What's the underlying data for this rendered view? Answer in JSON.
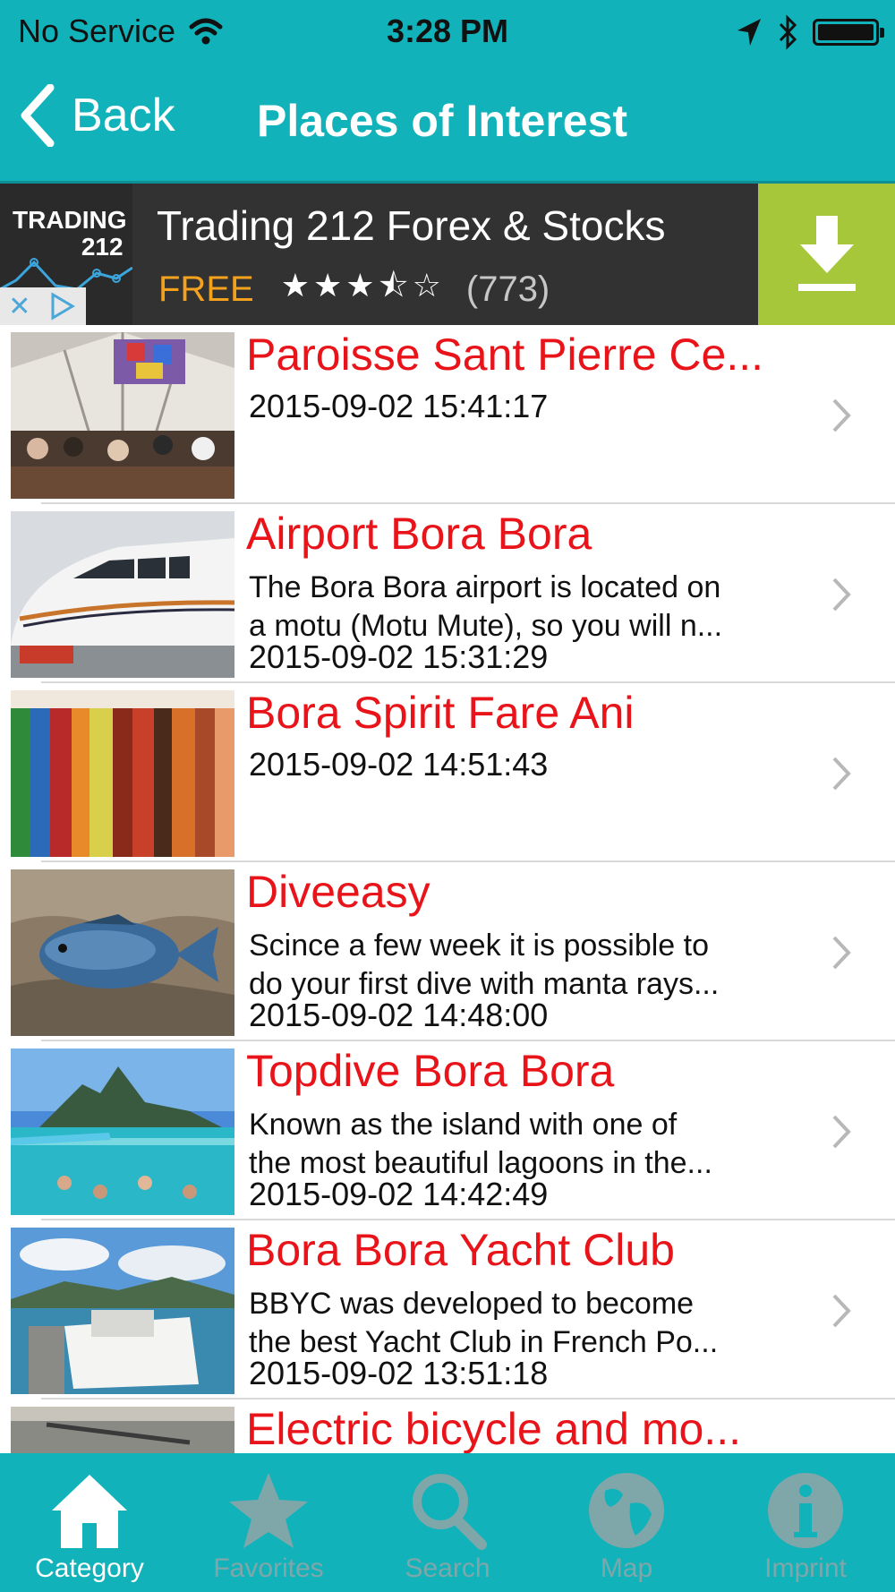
{
  "status_bar": {
    "carrier": "No Service",
    "time": "3:28 PM"
  },
  "nav": {
    "back_label": "Back",
    "title": "Places of Interest"
  },
  "ad": {
    "logo_line1": "TRADING",
    "logo_line2": "212",
    "title": "Trading 212 Forex & Stocks",
    "price": "FREE",
    "stars": "★★★⯪☆",
    "rating_count": "(773)"
  },
  "items": [
    {
      "title": "Paroisse Sant Pierre Ce...",
      "desc1": "",
      "desc2": "",
      "date": "2015-09-02 15:41:17",
      "thumb": "church-interior"
    },
    {
      "title": "Airport Bora Bora",
      "desc1": "The Bora Bora airport is located on",
      "desc2": "a motu (Motu Mute), so you will n...",
      "date": "2015-09-02 15:31:29",
      "thumb": "airplane"
    },
    {
      "title": "Bora Spirit Fare Ani",
      "desc1": "",
      "desc2": "",
      "date": "2015-09-02 14:51:43",
      "thumb": "colorful-strings"
    },
    {
      "title": "Diveeasy",
      "desc1": "Scince a few week it is possible to",
      "desc2": "do your first dive with manta rays...",
      "date": "2015-09-02 14:48:00",
      "thumb": "fish-reef"
    },
    {
      "title": "Topdive Bora Bora",
      "desc1": "Known as the island with one of",
      "desc2": "the most beautiful lagoons in the...",
      "date": "2015-09-02 14:42:49",
      "thumb": "island-lagoon"
    },
    {
      "title": "Bora Bora Yacht Club",
      "desc1": "BBYC was developed to become",
      "desc2": "the best Yacht Club in French Po...",
      "date": "2015-09-02 13:51:18",
      "thumb": "yacht"
    },
    {
      "title": "Electric bicycle and mo...",
      "desc1": "",
      "desc2": "",
      "date": "",
      "thumb": "bicycle"
    }
  ],
  "tabs": [
    {
      "label": "Category",
      "icon": "home-icon"
    },
    {
      "label": "Favorites",
      "icon": "star-icon"
    },
    {
      "label": "Search",
      "icon": "search-icon"
    },
    {
      "label": "Map",
      "icon": "globe-icon"
    },
    {
      "label": "Imprint",
      "icon": "info-icon"
    }
  ],
  "colors": {
    "bar": "#12b2bb",
    "title_red": "#e8141a",
    "ad_green": "#a5c739",
    "ad_orange": "#f4a21d"
  }
}
